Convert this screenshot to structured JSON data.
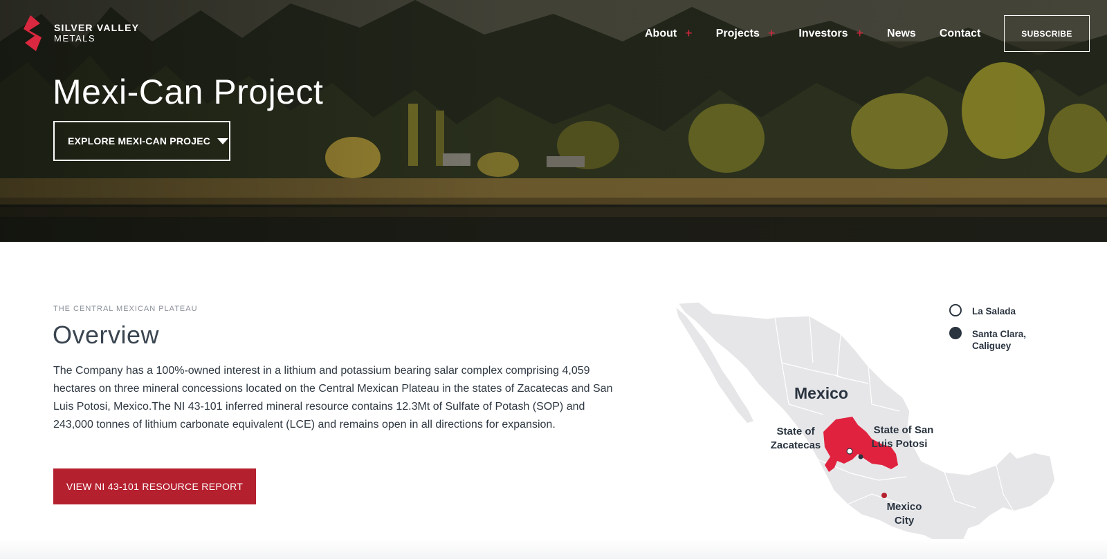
{
  "brand": {
    "line1": "SILVER VALLEY",
    "line2": "METALS",
    "accent_color": "#d9283f"
  },
  "nav": {
    "items": [
      {
        "label": "About",
        "has_submenu": true
      },
      {
        "label": "Projects",
        "has_submenu": true
      },
      {
        "label": "Investors",
        "has_submenu": true
      },
      {
        "label": "News",
        "has_submenu": false
      },
      {
        "label": "Contact",
        "has_submenu": false
      }
    ],
    "plus": "+",
    "subscribe": "SUBSCRIBE"
  },
  "hero": {
    "title": "Mexi-Can Project",
    "explore_label": "EXPLORE MEXI-CAN PROJEC"
  },
  "overview": {
    "eyebrow": "THE CENTRAL MEXICAN PLATEAU",
    "title": "Overview",
    "body": "The Company has a 100%-owned interest in a lithium and potassium bearing salar complex comprising 4,059 hectares on three mineral concessions located on the Central Mexican Plateau in the states of Zacatecas and San Luis Potosi, Mexico.The NI 43-101 inferred mineral resource contains 12.3Mt of Sulfate of Potash (SOP) and 243,000 tonnes of lithium carbonate equivalent (LCE) and remains open in all directions for expansion.",
    "button": "VIEW NI 43-101 RESOURCE REPORT",
    "button_color": "#b5202f"
  },
  "map": {
    "country": "Mexico",
    "state1_line1": "State of",
    "state1_line2": "Zacatecas",
    "state2_line1": "State of San",
    "state2_line2": "Luis Potosi",
    "city_line1": "Mexico",
    "city_line2": "City",
    "highlight_color": "#e0223f",
    "land_color": "#e6e6e8",
    "legend": [
      {
        "label": "La Salada",
        "style": "open"
      },
      {
        "label": "Santa Clara, Caliguey",
        "style": "filled"
      }
    ]
  }
}
